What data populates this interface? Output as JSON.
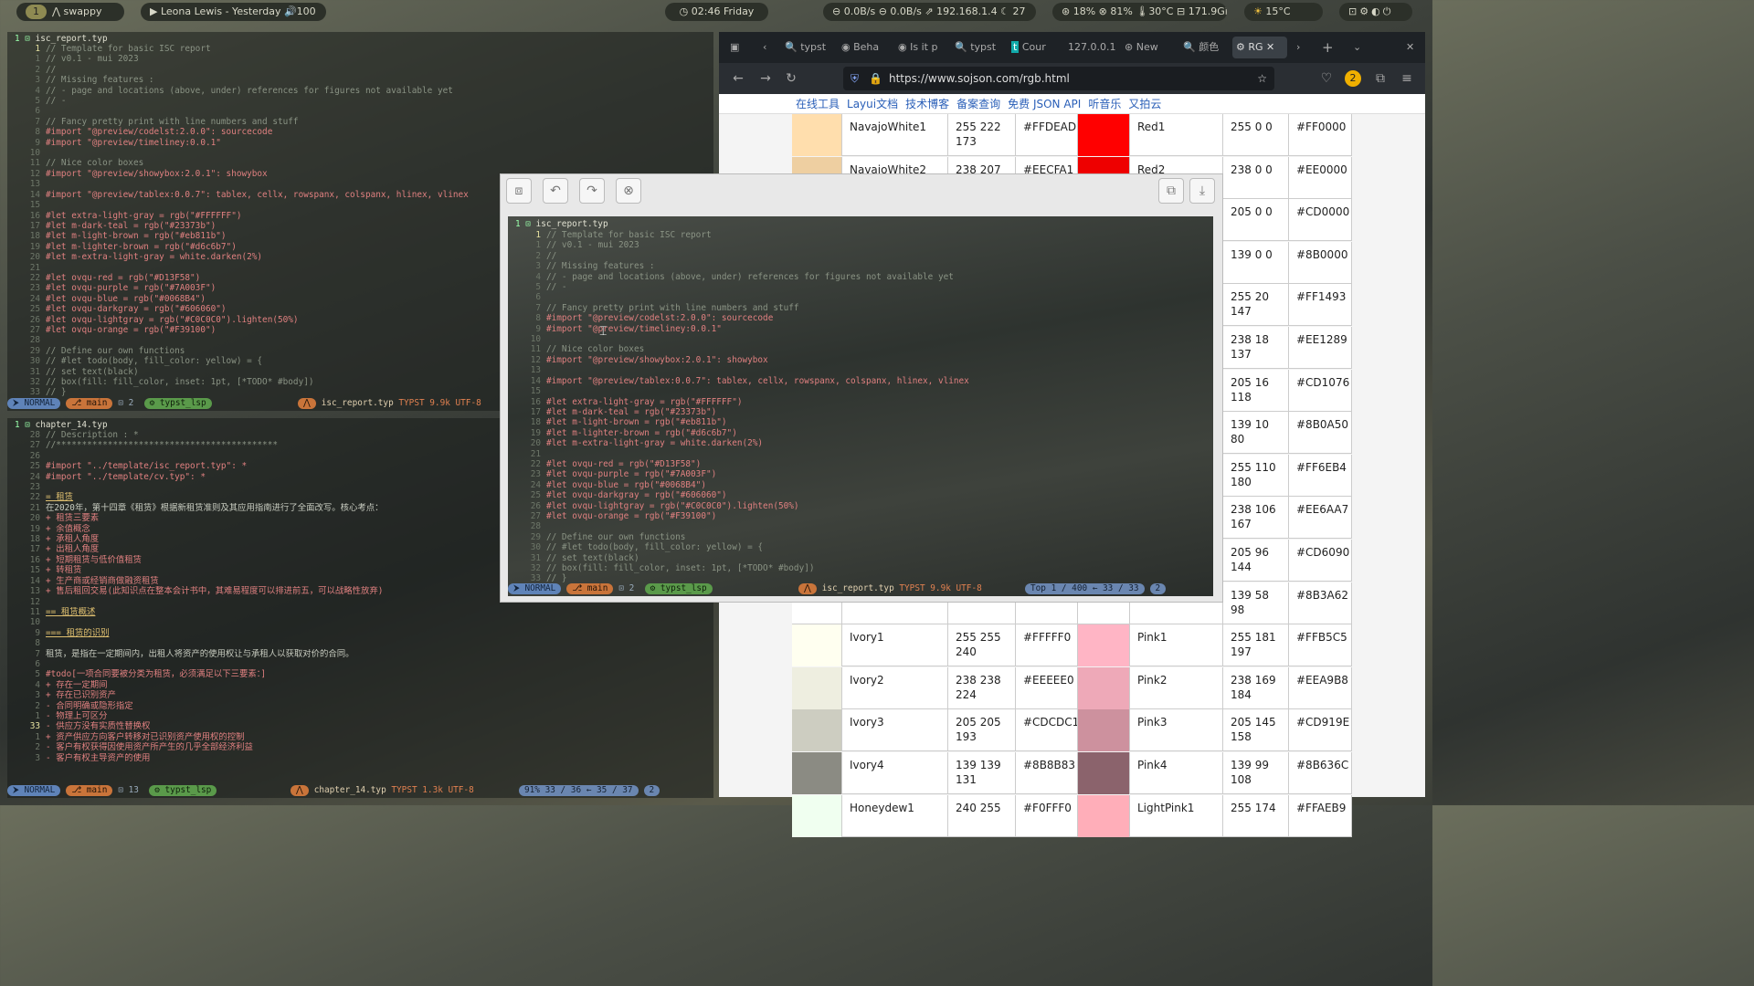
{
  "topbar": {
    "workspace": "1",
    "app": "swappy",
    "media": "Leona Lewis - Yesterday",
    "volume": "100",
    "clock": "02:46 Friday",
    "net_down": "0.0B/s",
    "net_up": "0.0B/s",
    "ip": "192.168.1.4",
    "net_extra": "27",
    "cpu": "18%",
    "mem": "81%",
    "temp": "30°C",
    "disk": "171.9GiB",
    "weather": "15°C"
  },
  "editor_top": {
    "title": "isc_report.typ",
    "lines": [
      {
        "n": "1",
        "t": "// Template for basic ISC report",
        "c": "c-comment",
        "cur": true
      },
      {
        "n": "1",
        "t": "// v0.1 - mui 2023",
        "c": "c-comment"
      },
      {
        "n": "2",
        "t": "//",
        "c": "c-comment"
      },
      {
        "n": "3",
        "t": "// Missing features :",
        "c": "c-comment"
      },
      {
        "n": "4",
        "t": "// - page and locations (above, under) references for figures not available yet",
        "c": "c-comment"
      },
      {
        "n": "5",
        "t": "// -",
        "c": "c-comment"
      },
      {
        "n": "6",
        "t": "",
        "c": "c-text"
      },
      {
        "n": "7",
        "t": "// Fancy pretty print with line numbers and stuff",
        "c": "c-comment"
      },
      {
        "n": "8",
        "t": "#import \"@preview/codelst:2.0.0\": sourcecode",
        "c": "c-import"
      },
      {
        "n": "9",
        "t": "#import \"@preview/timeliney:0.0.1\"",
        "c": "c-import"
      },
      {
        "n": "10",
        "t": "",
        "c": "c-text"
      },
      {
        "n": "11",
        "t": "// Nice color boxes",
        "c": "c-comment"
      },
      {
        "n": "12",
        "t": "#import \"@preview/showybox:2.0.1\": showybox",
        "c": "c-import"
      },
      {
        "n": "13",
        "t": "",
        "c": "c-text"
      },
      {
        "n": "14",
        "t": "#import \"@preview/tablex:0.0.7\": tablex, cellx, rowspanx, colspanx, hlinex, vlinex",
        "c": "c-import"
      },
      {
        "n": "15",
        "t": "",
        "c": "c-text"
      },
      {
        "n": "16",
        "t": "#let extra-light-gray = rgb(\"#FFFFFF\")",
        "c": "c-let"
      },
      {
        "n": "17",
        "t": "#let m-dark-teal = rgb(\"#23373b\")",
        "c": "c-let"
      },
      {
        "n": "18",
        "t": "#let m-light-brown = rgb(\"#eb811b\")",
        "c": "c-let"
      },
      {
        "n": "19",
        "t": "#let m-lighter-brown = rgb(\"#d6c6b7\")",
        "c": "c-let"
      },
      {
        "n": "20",
        "t": "#let m-extra-light-gray = white.darken(2%)",
        "c": "c-let"
      },
      {
        "n": "21",
        "t": "",
        "c": "c-text"
      },
      {
        "n": "22",
        "t": "#let ovqu-red = rgb(\"#D13F58\")",
        "c": "c-let"
      },
      {
        "n": "23",
        "t": "#let ovqu-purple = rgb(\"#7A003F\")",
        "c": "c-let"
      },
      {
        "n": "24",
        "t": "#let ovqu-blue = rgb(\"#0068B4\")",
        "c": "c-let"
      },
      {
        "n": "25",
        "t": "#let ovqu-darkgray = rgb(\"#606060\")",
        "c": "c-let"
      },
      {
        "n": "26",
        "t": "#let ovqu-lightgray = rgb(\"#C0C0C0\").lighten(50%)",
        "c": "c-let"
      },
      {
        "n": "27",
        "t": "#let ovqu-orange = rgb(\"#F39100\")",
        "c": "c-let"
      },
      {
        "n": "28",
        "t": "",
        "c": "c-text"
      },
      {
        "n": "29",
        "t": "// Define our own functions",
        "c": "c-comment"
      },
      {
        "n": "30",
        "t": "// #let todo(body, fill_color: yellow) = {",
        "c": "c-comment"
      },
      {
        "n": "31",
        "t": "//   set text(black)",
        "c": "c-comment"
      },
      {
        "n": "32",
        "t": "//   box(fill: fill_color, inset: 1pt, [*TODO* #body])",
        "c": "c-comment"
      },
      {
        "n": "33",
        "t": "// }",
        "c": "c-comment"
      }
    ],
    "status": {
      "mode": "NORMAL",
      "branch": "main",
      "changes": "2",
      "lsp": "typst_lsp",
      "file": "isc_report.typ",
      "ft": "TYPST",
      "size": "9.9k",
      "enc": "UTF-8"
    }
  },
  "editor_bottom": {
    "title": "chapter_14.typ",
    "lines": [
      {
        "n": "28",
        "t": "// Description :                              *",
        "c": "c-comment"
      },
      {
        "n": "27",
        "t": "//*******************************************",
        "c": "c-comment"
      },
      {
        "n": "26",
        "t": "",
        "c": "c-text"
      },
      {
        "n": "25",
        "t": "#import \"../template/isc_report.typ\": *",
        "c": "c-import"
      },
      {
        "n": "24",
        "t": "#import \"../template/cv.typ\": *",
        "c": "c-import"
      },
      {
        "n": "23",
        "t": "",
        "c": "c-text"
      },
      {
        "n": "22",
        "t": "= 租赁",
        "c": "c-head"
      },
      {
        "n": "21",
        "t": "在2020年，第十四章《租赁》根据新租赁准则及其应用指南进行了全面改写。核心考点：",
        "c": "c-text"
      },
      {
        "n": "20",
        "t": "+ 租赁三要素",
        "c": "c-list"
      },
      {
        "n": "19",
        "t": "+ 余值概念",
        "c": "c-list"
      },
      {
        "n": "18",
        "t": "+ 承租人角度",
        "c": "c-list"
      },
      {
        "n": "17",
        "t": "+ 出租人角度",
        "c": "c-list"
      },
      {
        "n": "16",
        "t": "+ 短期租赁与低价值租赁",
        "c": "c-list"
      },
      {
        "n": "15",
        "t": "+ 转租赁",
        "c": "c-list"
      },
      {
        "n": "14",
        "t": "+ 生产商或经销商做融资租赁",
        "c": "c-list"
      },
      {
        "n": "13",
        "t": "+ 售后租回交易(此知识点在整本会计书中，其难易程度可以排进前五，可以战略性放弃)",
        "c": "c-list"
      },
      {
        "n": "12",
        "t": "",
        "c": "c-text"
      },
      {
        "n": "11",
        "t": "== 租赁概述",
        "c": "c-head"
      },
      {
        "n": "10",
        "t": "",
        "c": "c-text"
      },
      {
        "n": "9",
        "t": "=== 租赁的识别",
        "c": "c-head"
      },
      {
        "n": "8",
        "t": "",
        "c": "c-text"
      },
      {
        "n": "7",
        "t": "租赁，是指在一定期间内，出租人将资产的使用权让与承租人以获取对价的合同。",
        "c": "c-text"
      },
      {
        "n": "6",
        "t": "",
        "c": "c-text"
      },
      {
        "n": "5",
        "t": "#todo[一项合同要被分类为租赁，必须满足以下三要素：]",
        "c": "c-todo"
      },
      {
        "n": "4",
        "t": "+ 存在一定期间",
        "c": "c-list"
      },
      {
        "n": "3",
        "t": "+ 存在已识别资产",
        "c": "c-list"
      },
      {
        "n": "2",
        "t": "  - 合同明确或隐形指定",
        "c": "c-list"
      },
      {
        "n": "1",
        "t": "  - 物理上可区分",
        "c": "c-list"
      },
      {
        "n": "33",
        "t": "  - 供应方没有实质性替换权",
        "c": "c-list",
        "cur": true
      },
      {
        "n": "1",
        "t": "+ 资产供应方向客户转移对已识别资产使用权的控制",
        "c": "c-list"
      },
      {
        "n": "2",
        "t": "  - 客户有权获得因使用资产所产生的几乎全部经济利益",
        "c": "c-list"
      },
      {
        "n": "3",
        "t": "  - 客户有权主导资产的使用",
        "c": "c-list"
      }
    ],
    "status": {
      "mode": "NORMAL",
      "branch": "main",
      "changes": "13",
      "lsp": "typst_lsp",
      "file": "chapter_14.typ",
      "ft": "TYPST",
      "size": "1.3k",
      "enc": "UTF-8",
      "pos": "91% 33 / 36 ← 35 / 37",
      "extra": "2"
    }
  },
  "browser": {
    "tabs": [
      "typst",
      "Beha",
      "Is it p",
      "typst",
      "Cour",
      "127.0.0.1",
      "New",
      "颜色",
      "RG"
    ],
    "url": "https://www.sojson.com/rgb.html",
    "site_nav": [
      "在线工具",
      "Layui文档",
      "技术博客",
      "备案查询",
      "免费 JSON API",
      "听音乐",
      "又拍云"
    ],
    "rows": [
      {
        "n1": "NavajoWhite1",
        "rgb1": "255 222 173",
        "hex1": "#FFDEAD",
        "sw1": "#ffdead",
        "n2": "Red1",
        "rgb2": "255 0 0",
        "hex2": "#FF0000",
        "sw2": "#ff0000"
      },
      {
        "n1": "NavajoWhite2",
        "rgb1": "238 207",
        "hex1": "#EECFA1",
        "sw1": "#eecfa1",
        "n2": "Red2",
        "rgb2": "238 0 0",
        "hex2": "#EE0000",
        "sw2": "#ee0000"
      },
      {
        "n1": "",
        "rgb1": "",
        "hex1": "",
        "sw1": "",
        "n2": "",
        "rgb2": "205 0 0",
        "hex2": "#CD0000",
        "sw2": ""
      },
      {
        "n1": "",
        "rgb1": "",
        "hex1": "",
        "sw1": "",
        "n2": "",
        "rgb2": "139 0 0",
        "hex2": "#8B0000",
        "sw2": ""
      },
      {
        "n1": "",
        "rgb1": "",
        "hex1": "",
        "sw1": "",
        "n2": "",
        "rgb2": "255 20 147",
        "hex2": "#FF1493",
        "sw2": ""
      },
      {
        "n1": "",
        "rgb1": "",
        "hex1": "",
        "sw1": "",
        "n2": "",
        "rgb2": "238 18 137",
        "hex2": "#EE1289",
        "sw2": ""
      },
      {
        "n1": "",
        "rgb1": "",
        "hex1": "",
        "sw1": "",
        "n2": "",
        "rgb2": "205 16 118",
        "hex2": "#CD1076",
        "sw2": ""
      },
      {
        "n1": "",
        "rgb1": "",
        "hex1": "",
        "sw1": "",
        "n2": "",
        "rgb2": "139 10 80",
        "hex2": "#8B0A50",
        "sw2": ""
      },
      {
        "n1": "",
        "rgb1": "",
        "hex1": "",
        "sw1": "",
        "n2": "",
        "rgb2": "255 110 180",
        "hex2": "#FF6EB4",
        "sw2": ""
      },
      {
        "n1": "",
        "rgb1": "",
        "hex1": "",
        "sw1": "",
        "n2": "",
        "rgb2": "238 106 167",
        "hex2": "#EE6AA7",
        "sw2": ""
      },
      {
        "n1": "",
        "rgb1": "",
        "hex1": "",
        "sw1": "",
        "n2": "",
        "rgb2": "205 96 144",
        "hex2": "#CD6090",
        "sw2": ""
      },
      {
        "n1": "",
        "rgb1": "",
        "hex1": "",
        "sw1": "",
        "n2": "",
        "rgb2": "139 58 98",
        "hex2": "#8B3A62",
        "sw2": ""
      },
      {
        "n1": "Ivory1",
        "rgb1": "255 255 240",
        "hex1": "#FFFFF0",
        "sw1": "#fffff0",
        "n2": "Pink1",
        "rgb2": "255 181 197",
        "hex2": "#FFB5C5",
        "sw2": "#ffb5c5"
      },
      {
        "n1": "Ivory2",
        "rgb1": "238 238 224",
        "hex1": "#EEEEE0",
        "sw1": "#eeeee0",
        "n2": "Pink2",
        "rgb2": "238 169 184",
        "hex2": "#EEA9B8",
        "sw2": "#eea9b8"
      },
      {
        "n1": "Ivory3",
        "rgb1": "205 205 193",
        "hex1": "#CDCDC1",
        "sw1": "#cdcdc1",
        "n2": "Pink3",
        "rgb2": "205 145 158",
        "hex2": "#CD919E",
        "sw2": "#cd919e"
      },
      {
        "n1": "Ivory4",
        "rgb1": "139 139 131",
        "hex1": "#8B8B83",
        "sw1": "#8b8b83",
        "n2": "Pink4",
        "rgb2": "139 99 108",
        "hex2": "#8B636C",
        "sw2": "#8b636c"
      },
      {
        "n1": "Honeydew1",
        "rgb1": "240 255",
        "hex1": "#F0FFF0",
        "sw1": "#f0fff0",
        "n2": "LightPink1",
        "rgb2": "255 174",
        "hex2": "#FFAEB9",
        "sw2": "#ffaeb9"
      }
    ]
  },
  "preview": {
    "status_extra": {
      "pos_label": "Top",
      "pos": "1 / 400 ← 33 / 33",
      "extra": "2"
    }
  }
}
